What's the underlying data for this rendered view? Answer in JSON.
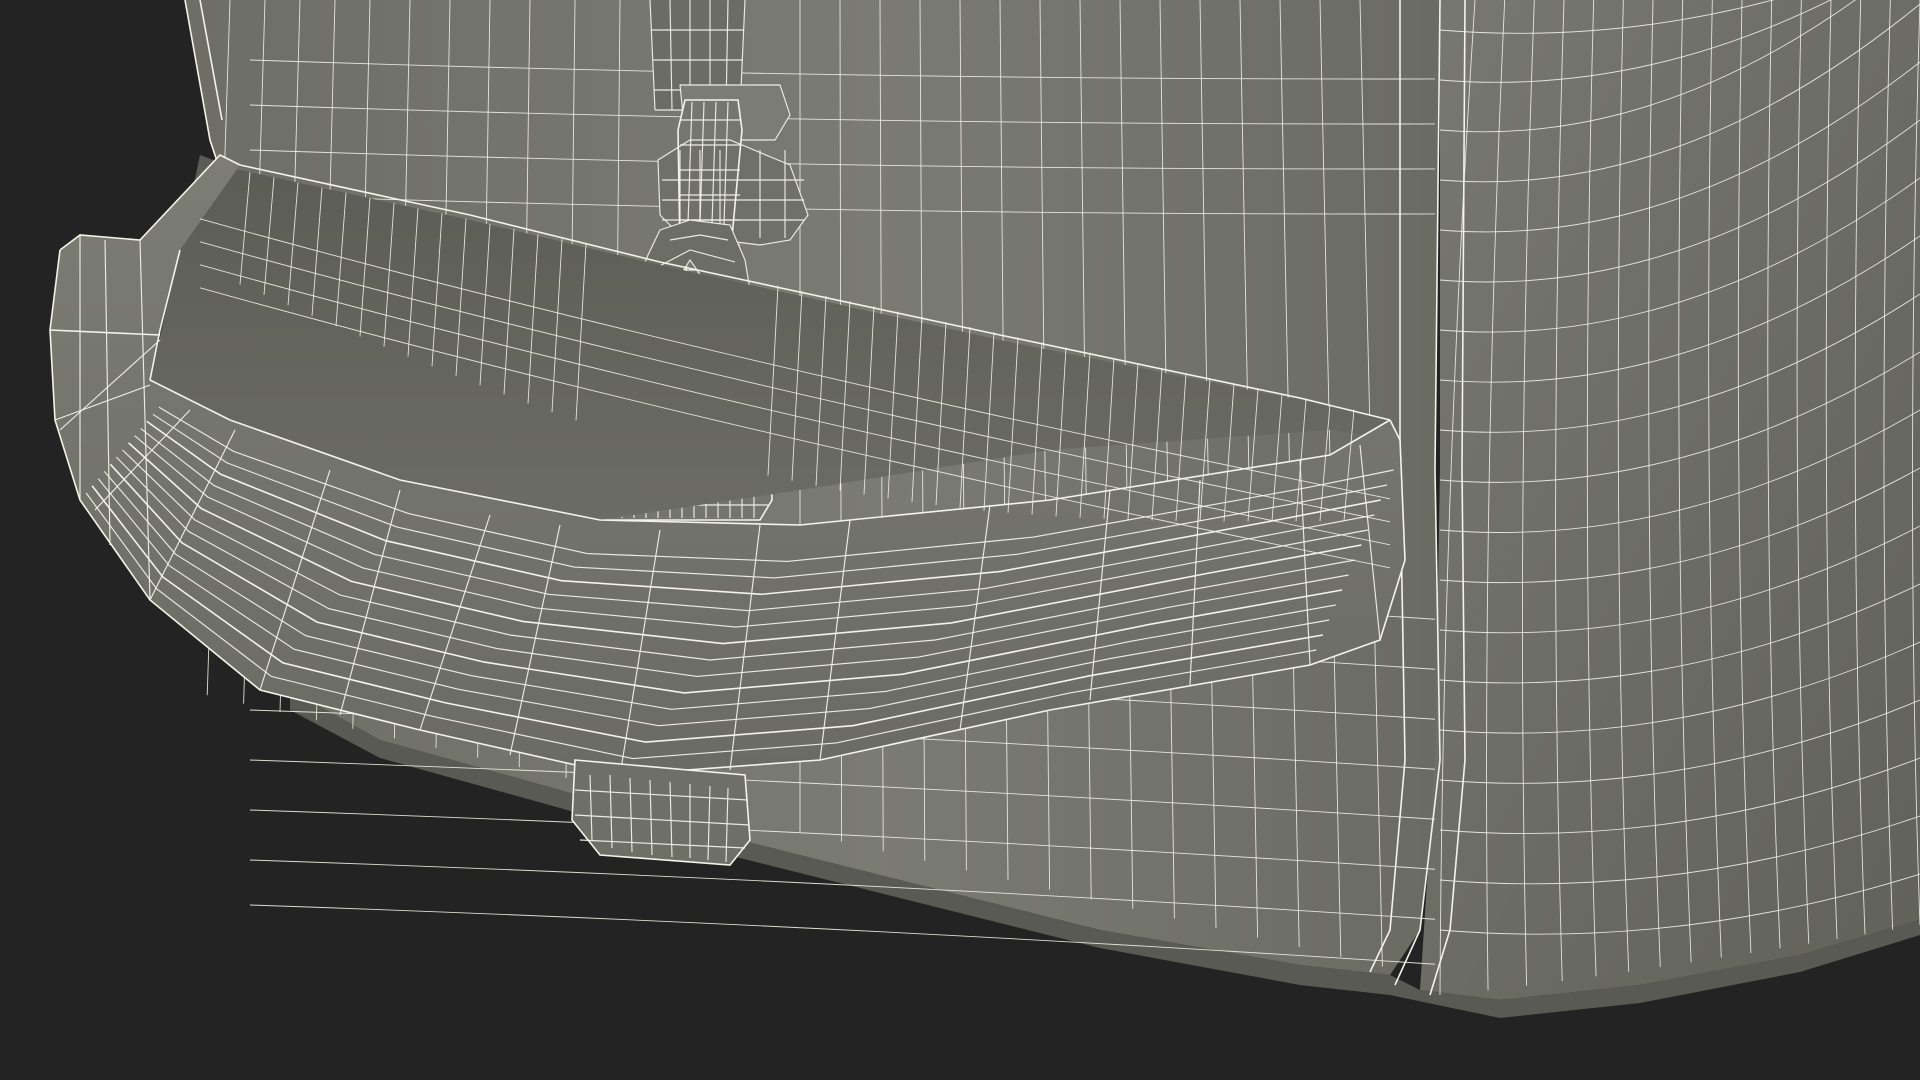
{
  "viewport": {
    "background": "#232323",
    "render_mode": "wireframe-over-shaded"
  },
  "model": {
    "subject": "backpack-bottom-with-front-pocket-and-zipper-pull",
    "surface_color": "#72736a",
    "surface_dark": "#5f6058",
    "surface_light": "#828378",
    "wire_color": "#f2f1e6"
  }
}
